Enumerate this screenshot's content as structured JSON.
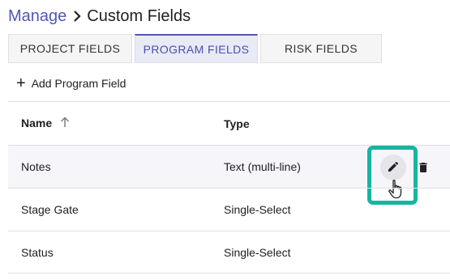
{
  "breadcrumb": {
    "parent": "Manage",
    "current": "Custom Fields"
  },
  "tabs": [
    {
      "label": "PROJECT FIELDS",
      "active": false
    },
    {
      "label": "PROGRAM FIELDS",
      "active": true
    },
    {
      "label": "RISK FIELDS",
      "active": false
    }
  ],
  "add_field": {
    "icon": "+",
    "label": "Add Program Field"
  },
  "table": {
    "columns": {
      "name": "Name",
      "type": "Type"
    },
    "sort": {
      "column": "Name",
      "direction": "ascending"
    },
    "rows": [
      {
        "name": "Notes",
        "type": "Text (multi-line)"
      },
      {
        "name": "Stage Gate",
        "type": "Single-Select"
      },
      {
        "name": "Status",
        "type": "Single-Select"
      }
    ]
  },
  "icons": {
    "edit": "pencil-icon",
    "delete": "trash-icon",
    "sort": "arrow-up-icon",
    "cursor": "hand-pointer-icon"
  },
  "colors": {
    "accent": "#5357b6",
    "highlight_frame": "#17b5a0",
    "active_tab_bg": "#e8eaf6"
  }
}
